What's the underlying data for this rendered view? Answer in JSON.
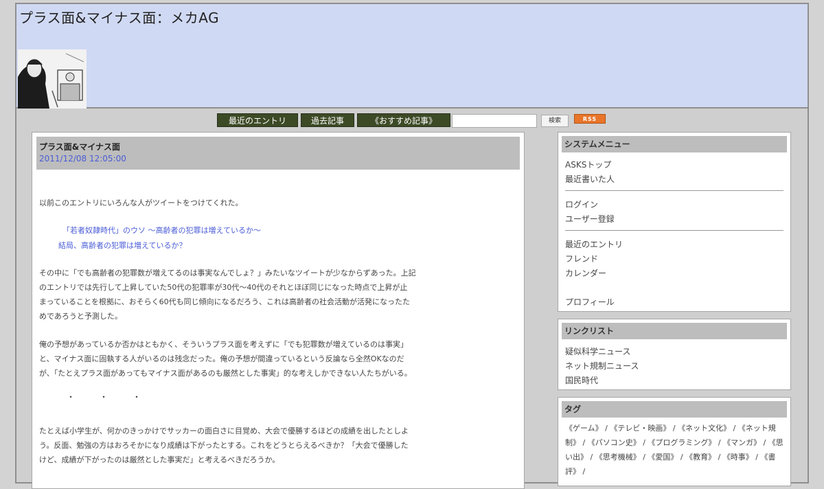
{
  "site": {
    "title": "プラス面&マイナス面：メカAG"
  },
  "nav": {
    "recent": "最近のエントリ",
    "archive": "過去記事",
    "recommended": "《おすすめ記事》",
    "search_button": "検索",
    "rss": "RSS"
  },
  "article": {
    "title": "プラス面&マイナス面",
    "date": "2011/12/08 12:05:00",
    "p1": "以前このエントリにいろんな人がツイートをつけてくれた。",
    "link1": "「若者奴隷時代」のウソ 〜高齢者の犯罪は増えているか〜",
    "link2": "結局、高齢者の犯罪は増えているか？",
    "p2_l1": "その中に「でも高齢者の犯罪数が増えてるのは事実なんでしょ？」みたいなツイートが少なからずあった。上記",
    "p2_l2": "のエントリでは先行して上昇していた50代の犯罪率が30代〜40代のそれとほぼ同じになった時点で上昇が止",
    "p2_l3": "まっていることを根拠に、おそらく60代も同じ傾向になるだろう、これは高齢者の社会活動が活発になったた",
    "p2_l4": "めであろうと予測した。",
    "p3_l1": "俺の予想があっているか否かはともかく、そういうプラス面を考えずに「でも犯罪数が増えているのは事実」",
    "p3_l2": "と、マイナス面に固執する人がいるのは残念だった。俺の予想が間違っているという反論なら全然OKなのだ",
    "p3_l3": "が、「たとえプラス面があってもマイナス面があるのも厳然とした事実」的な考えしかできない人たちがいる。",
    "dots": "・・・",
    "p4_l1": "たとえば小学生が、何かのきっかけでサッカーの面白さに目覚め、大会で優勝するほどの成績を出したとしよ",
    "p4_l2": "う。反面、勉強の方はおろそかになり成績は下がったとする。これをどうとらえるべきか？「大会で優勝した",
    "p4_l3": "けど、成績が下がったのは厳然とした事実だ」と考えるべきだろうか。"
  },
  "sidebar": {
    "system": {
      "heading": "システムメニュー",
      "asks_top": "ASKSトップ",
      "recent_writers": "最近書いた人",
      "login": "ログイン",
      "register": "ユーザー登録",
      "recent_entries": "最近のエントリ",
      "friends": "フレンド",
      "calendar": "カレンダー",
      "profile": "プロフィール"
    },
    "links": {
      "heading": "リンクリスト",
      "item1": "疑似科学ニュース",
      "item2": "ネット規制ニュース",
      "item3": "国民時代"
    },
    "tags": {
      "heading": "タグ",
      "text": "《ゲーム》 / 《テレビ・映画》 / 《ネット文化》 / 《ネット規制》 / 《パソコン史》 / 《プログラミング》 / 《マンガ》 / 《思い出》 / 《思考機械》 / 《愛国》 / 《教育》 / 《時事》 / 《書評》 /"
    }
  }
}
